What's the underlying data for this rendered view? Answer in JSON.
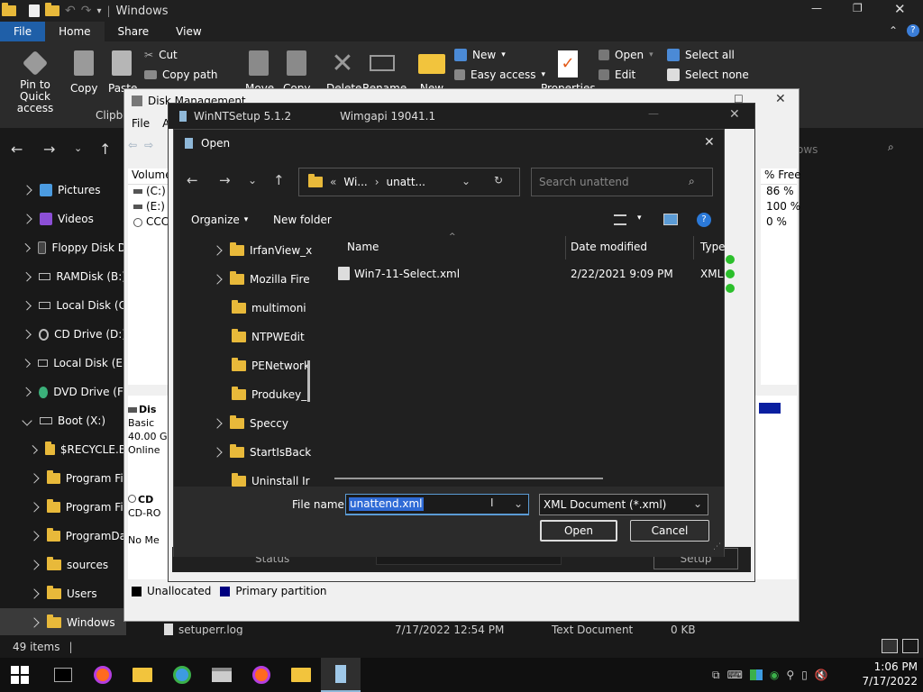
{
  "explorer": {
    "title": "Windows",
    "tabs": {
      "file": "File",
      "home": "Home",
      "share": "Share",
      "view": "View"
    },
    "ribbon": {
      "pin": "Pin to Quick\naccess",
      "copy": "Copy",
      "paste": "Paste",
      "cut": "Cut",
      "copy_path": "Copy path",
      "clipboard_group": "Clipbo",
      "move": "Move",
      "copy_to": "Copy",
      "delete": "Delete",
      "rename": "Rename",
      "new_folder": "New",
      "new_item": "New",
      "easy_access": "Easy access",
      "properties": "Properties",
      "open": "Open",
      "edit": "Edit",
      "select_all": "Select all",
      "select_none": "Select none"
    },
    "search_placeholder": "ows",
    "sidebar": [
      {
        "label": "Pictures",
        "icon": "pictures-icon"
      },
      {
        "label": "Videos",
        "icon": "videos-icon"
      },
      {
        "label": "Floppy Disk D",
        "icon": "floppy-icon"
      },
      {
        "label": "RAMDisk (B:)",
        "icon": "drive-icon"
      },
      {
        "label": "Local Disk (C",
        "icon": "drive-icon"
      },
      {
        "label": "CD Drive (D:)",
        "icon": "cd-icon"
      },
      {
        "label": "Local Disk (E:",
        "icon": "drive-icon"
      },
      {
        "label": "DVD Drive (F:",
        "icon": "dvd-icon"
      },
      {
        "label": "Boot (X:)",
        "icon": "drive-icon"
      },
      {
        "label": "$RECYCLE.B",
        "icon": "folder-icon"
      },
      {
        "label": "Program Fil",
        "icon": "folder-icon"
      },
      {
        "label": "Program Fil",
        "icon": "folder-icon"
      },
      {
        "label": "ProgramDa",
        "icon": "folder-icon"
      },
      {
        "label": "sources",
        "icon": "folder-icon"
      },
      {
        "label": "Users",
        "icon": "folder-icon"
      },
      {
        "label": "Windows",
        "icon": "folder-icon"
      }
    ],
    "status_items": "49 items",
    "bottom_row": {
      "name": "setuperr.log",
      "date": "7/17/2022 12:54 PM",
      "type": "Text Document",
      "size": "0 KB"
    }
  },
  "disk_management": {
    "title": "Disk Management",
    "menu_file": "File",
    "menu_a": "A",
    "volume_header": "Volume",
    "volumes": [
      "(C:)",
      "(E:)",
      "CCC"
    ],
    "free_header": "% Free",
    "free_values": [
      "86 %",
      "100 %",
      "0 %"
    ],
    "disk0": {
      "label": "Dis",
      "type": "Basic",
      "size": "40.00 G",
      "status": "Online"
    },
    "cd0": {
      "label": "CD",
      "type": "CD-RO",
      "media": "No Me"
    },
    "legend_unallocated": "Unallocated",
    "legend_primary": "Primary partition",
    "colors": {
      "unallocated": "#000000",
      "primary": "#000080",
      "bar": "#0a1fa0"
    }
  },
  "winnt": {
    "title": "WinNTSetup 5.1.2",
    "wimgapi": "Wimgapi 19041.1",
    "status_label": "Status",
    "setup_button": "Setup"
  },
  "open_dialog": {
    "title": "Open",
    "breadcrumb_prefix": "«",
    "breadcrumb_1": "Wi...",
    "breadcrumb_2": "unatt...",
    "search_placeholder": "Search unattend",
    "organize": "Organize",
    "new_folder": "New folder",
    "tree": [
      {
        "label": "IrfanView_x",
        "expandable": true
      },
      {
        "label": "Mozilla Fire",
        "expandable": true
      },
      {
        "label": "multimoni",
        "expandable": false
      },
      {
        "label": "NTPWEdit",
        "expandable": false
      },
      {
        "label": "PENetwork",
        "expandable": false
      },
      {
        "label": "Produkey_",
        "expandable": false
      },
      {
        "label": "Speccy",
        "expandable": true
      },
      {
        "label": "StartIsBack",
        "expandable": true
      },
      {
        "label": "Uninstall Ir",
        "expandable": false
      }
    ],
    "columns": {
      "name": "Name",
      "date": "Date modified",
      "type": "Type"
    },
    "files": [
      {
        "name": "Win7-11-Select.xml",
        "date": "2/22/2021 9:09 PM",
        "type": "XML"
      }
    ],
    "file_name_label": "File name:",
    "file_name_value": "unattend.xml",
    "file_type": "XML Document (*.xml)",
    "open_button": "Open",
    "cancel_button": "Cancel"
  },
  "taskbar": {
    "apps": [
      "terminal-icon",
      "firefox-icon",
      "file-explorer-icon",
      "network-icon",
      "printer-icon",
      "firefox-icon",
      "folder-icon",
      "winntsetup-icon"
    ],
    "time": "1:06 PM",
    "date": "7/17/2022"
  }
}
